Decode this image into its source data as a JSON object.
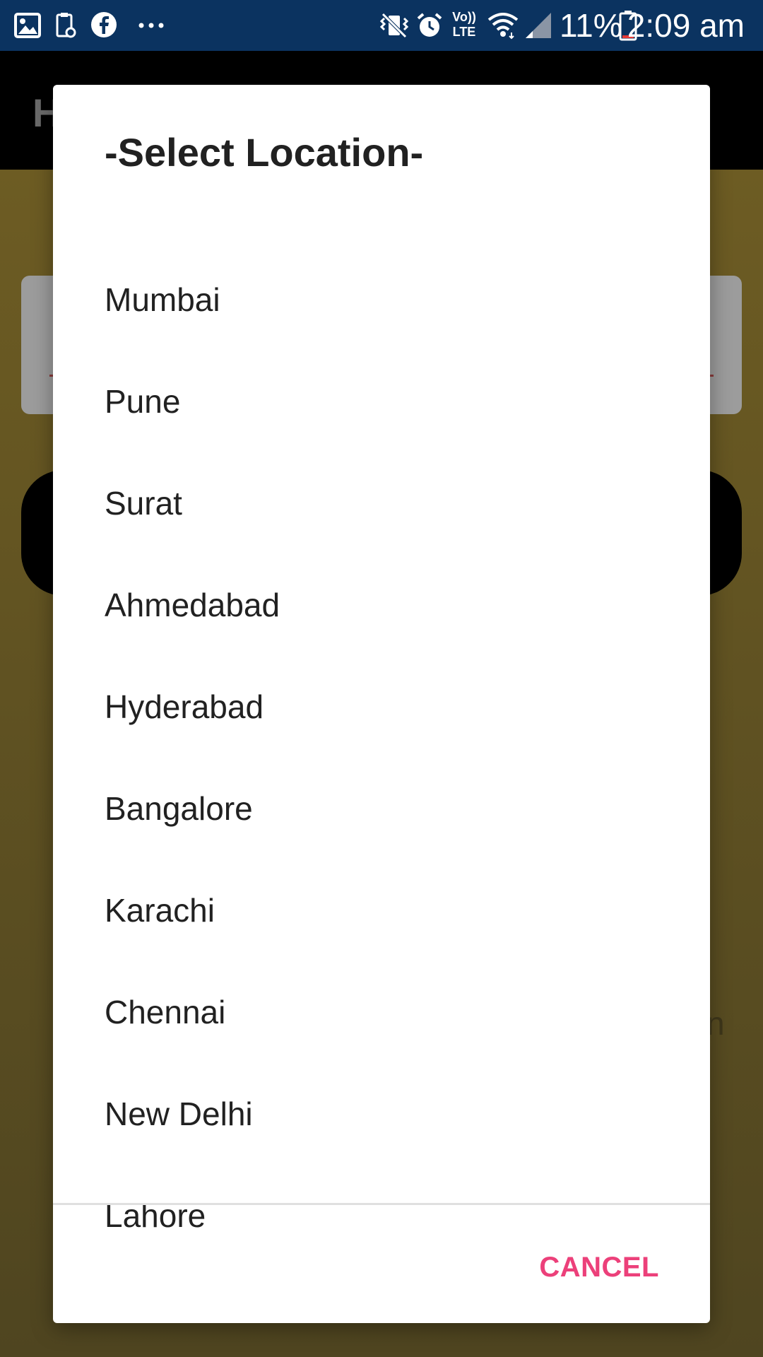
{
  "status_bar": {
    "icons_left": [
      "image-icon",
      "clipboard-icon",
      "facebook-icon",
      "more-icon"
    ],
    "icons_right": [
      "vibrate-icon",
      "alarm-icon",
      "volte-icon",
      "wifi-icon",
      "signal-icon",
      "battery-icon"
    ],
    "volte_label": "Vo)) LTE",
    "battery_percent": "11%",
    "time": "2:09 am"
  },
  "background_app": {
    "toolbar_title": "H",
    "text_fragment": "n",
    "colors": {
      "toolbar": "#000000",
      "content": "#6d5c23"
    }
  },
  "dialog": {
    "title": "-Select Location-",
    "options": [
      "Mumbai",
      "Pune",
      "Surat",
      "Ahmedabad",
      "Hyderabad",
      "Bangalore",
      "Karachi",
      "Chennai",
      "New Delhi",
      "Lahore"
    ],
    "cancel_label": "CANCEL",
    "colors": {
      "accent": "#ec407a",
      "text": "#212121"
    }
  }
}
